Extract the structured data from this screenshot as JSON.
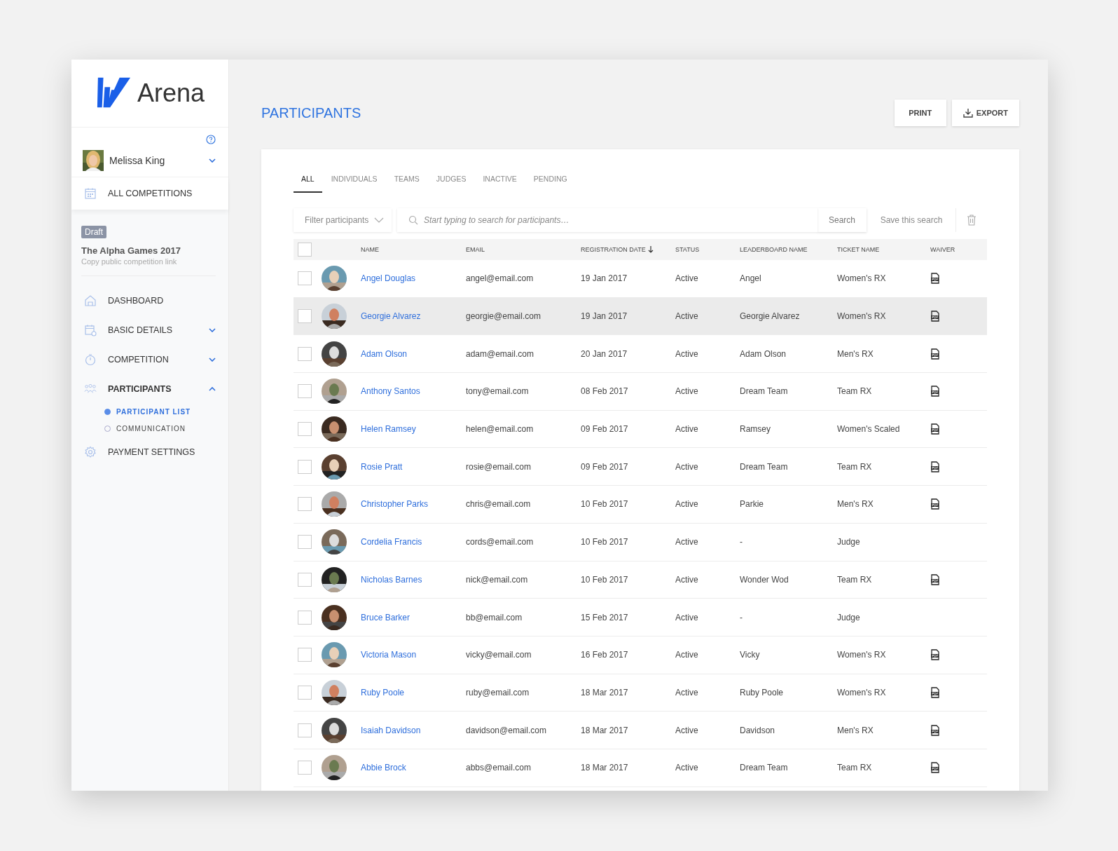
{
  "brand": {
    "name": "Arena"
  },
  "user": {
    "name": "Melissa King"
  },
  "all_competitions": "ALL COMPETITIONS",
  "competition": {
    "badge": "Draft",
    "title": "The Alpha Games 2017",
    "link": "Copy public competition link"
  },
  "nav": [
    {
      "label": "DASHBOARD",
      "selected": false
    },
    {
      "label": "BASIC DETAILS",
      "expanded": false,
      "selected": false
    },
    {
      "label": "COMPETITION",
      "expanded": false,
      "selected": false
    },
    {
      "label": "PARTICIPANTS",
      "expanded": true,
      "selected": true,
      "children": [
        {
          "label": "PARTICIPANT LIST",
          "selected": true
        },
        {
          "label": "COMMUNICATION",
          "selected": false
        }
      ]
    },
    {
      "label": "PAYMENT SETTINGS",
      "selected": false
    }
  ],
  "page_title": "PARTICIPANTS",
  "actions": [
    {
      "label": "PRINT"
    },
    {
      "label": "EXPORT"
    }
  ],
  "tabs": [
    {
      "label": "ALL",
      "selected": true
    },
    {
      "label": "INDIVIDUALS",
      "selected": false
    },
    {
      "label": "TEAMS",
      "selected": false
    },
    {
      "label": "JUDGES",
      "selected": false
    },
    {
      "label": "INACTIVE",
      "selected": false
    },
    {
      "label": "PENDING",
      "selected": false
    }
  ],
  "filter": {
    "label": "Filter participants"
  },
  "search": {
    "placeholder": "Start typing to search for participants…",
    "button": "Search",
    "save": "Save this search"
  },
  "table": {
    "select_all": {
      "checked": false
    },
    "columns": [
      "NAME",
      "EMAIL",
      "REGISTRATION DATE",
      "STATUS",
      "LEADERBOARD NAME",
      "TICKET NAME",
      "WAIVER"
    ],
    "rows": [
      {
        "name": "Angel Douglas",
        "email": "angel@email.com",
        "date": "19 Jan 2017",
        "status": "Active",
        "leaderboard": "Angel",
        "ticket": "Women's RX",
        "waiver": true,
        "checked": false,
        "highlighted": false
      },
      {
        "name": "Georgie Alvarez",
        "email": "georgie@email.com",
        "date": "19 Jan 2017",
        "status": "Active",
        "leaderboard": "Georgie Alvarez",
        "ticket": "Women's RX",
        "waiver": true,
        "checked": false,
        "highlighted": true
      },
      {
        "name": "Adam Olson",
        "email": "adam@email.com",
        "date": "20 Jan 2017",
        "status": "Active",
        "leaderboard": "Adam Olson",
        "ticket": "Men's RX",
        "waiver": true,
        "checked": false,
        "highlighted": false
      },
      {
        "name": "Anthony Santos",
        "email": "tony@email.com",
        "date": "08 Feb 2017",
        "status": "Active",
        "leaderboard": "Dream Team",
        "ticket": "Team RX",
        "waiver": true,
        "checked": false,
        "highlighted": false
      },
      {
        "name": "Helen Ramsey",
        "email": "helen@email.com",
        "date": "09 Feb 2017",
        "status": "Active",
        "leaderboard": "Ramsey",
        "ticket": "Women's Scaled",
        "waiver": true,
        "checked": false,
        "highlighted": false
      },
      {
        "name": "Rosie Pratt",
        "email": "rosie@email.com",
        "date": "09 Feb 2017",
        "status": "Active",
        "leaderboard": "Dream Team",
        "ticket": "Team RX",
        "waiver": true,
        "checked": false,
        "highlighted": false
      },
      {
        "name": "Christopher Parks",
        "email": "chris@email.com",
        "date": "10 Feb 2017",
        "status": "Active",
        "leaderboard": "Parkie",
        "ticket": "Men's RX",
        "waiver": true,
        "checked": false,
        "highlighted": false
      },
      {
        "name": "Cordelia Francis",
        "email": "cords@email.com",
        "date": "10 Feb 2017",
        "status": "Active",
        "leaderboard": "-",
        "ticket": "Judge",
        "waiver": false,
        "checked": false,
        "highlighted": false
      },
      {
        "name": "Nicholas Barnes",
        "email": "nick@email.com",
        "date": "10 Feb 2017",
        "status": "Active",
        "leaderboard": "Wonder Wod",
        "ticket": "Team RX",
        "waiver": true,
        "checked": false,
        "highlighted": false
      },
      {
        "name": "Bruce Barker",
        "email": "bb@email.com",
        "date": "15 Feb 2017",
        "status": "Active",
        "leaderboard": "-",
        "ticket": "Judge",
        "waiver": false,
        "checked": false,
        "highlighted": false
      },
      {
        "name": "Victoria Mason",
        "email": "vicky@email.com",
        "date": "16 Feb 2017",
        "status": "Active",
        "leaderboard": "Vicky",
        "ticket": "Women's RX",
        "waiver": true,
        "checked": false,
        "highlighted": false
      },
      {
        "name": "Ruby Poole",
        "email": "ruby@email.com",
        "date": "18 Mar 2017",
        "status": "Active",
        "leaderboard": "Ruby Poole",
        "ticket": "Women's RX",
        "waiver": true,
        "checked": false,
        "highlighted": false
      },
      {
        "name": "Isaiah Davidson",
        "email": "davidson@email.com",
        "date": "18 Mar 2017",
        "status": "Active",
        "leaderboard": "Davidson",
        "ticket": "Men's RX",
        "waiver": true,
        "checked": false,
        "highlighted": false
      },
      {
        "name": "Abbie Brock",
        "email": "abbs@email.com",
        "date": "18 Mar 2017",
        "status": "Active",
        "leaderboard": "Dream Team",
        "ticket": "Team RX",
        "waiver": true,
        "checked": false,
        "highlighted": false
      }
    ]
  }
}
